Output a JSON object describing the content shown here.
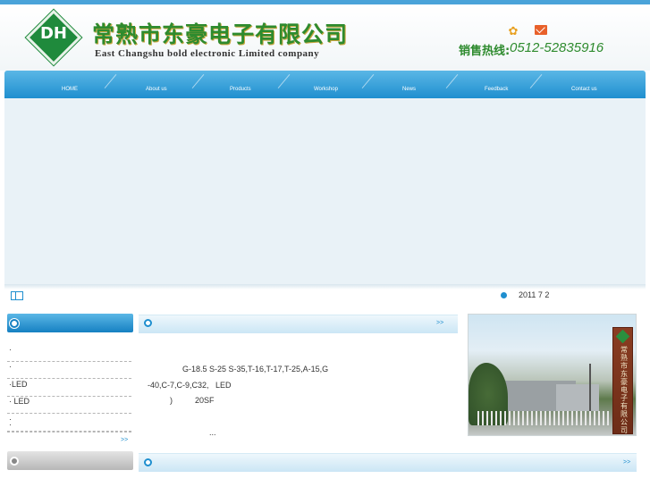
{
  "header": {
    "logo_text": "DH",
    "company_cn": "常熟市东豪电子有限公司",
    "company_en": "East Changshu bold electronic Limited company",
    "hotline_label": "销售热线:",
    "hotline_number": "0512-52835916",
    "icons": [
      "home-icon",
      "mail-icon"
    ]
  },
  "nav": {
    "items": [
      {
        "label": "HOME"
      },
      {
        "label": "About us"
      },
      {
        "label": "Products"
      },
      {
        "label": "Workshop"
      },
      {
        "label": "News"
      },
      {
        "label": "Feedback"
      },
      {
        "label": "Contact us"
      }
    ]
  },
  "ticker": {
    "date_text": "2011  7 2"
  },
  "sidebar": {
    "items": [
      {
        "label": "·"
      },
      {
        "label": "·"
      },
      {
        "label": "·LED"
      },
      {
        "label": "·  LED"
      },
      {
        "label": "·"
      },
      {
        "label": "·"
      }
    ],
    "more": ">>"
  },
  "main": {
    "panel1_more": ">>",
    "panel2_more": ">>",
    "lines": [
      "G-18.5 S-25 S-35,T-16,T-17,T-25,A-15,G",
      "-40,C-7,C-9,C32,   LED",
      ")          20SF",
      "..."
    ]
  },
  "photo": {
    "sign_text": "常熟市东豪电子有限公司"
  },
  "colors": {
    "brand_green": "#2e8b2e",
    "nav_blue": "#1f8fcf",
    "accent_orange": "#e8602a"
  }
}
